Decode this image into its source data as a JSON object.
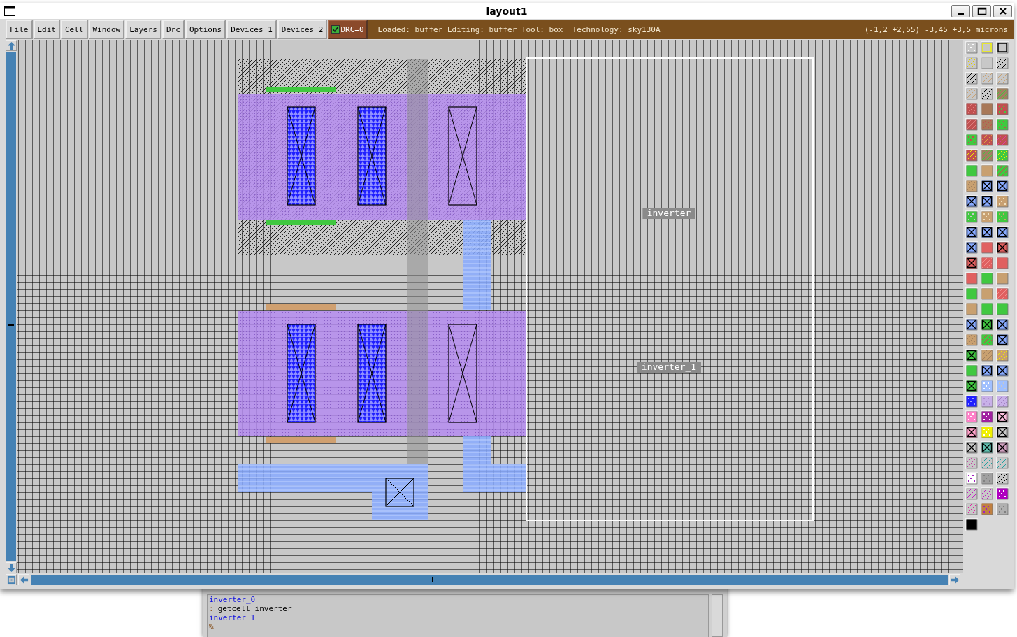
{
  "window": {
    "title": "layout1"
  },
  "menu": [
    "File",
    "Edit",
    "Cell",
    "Window",
    "Layers",
    "Drc",
    "Options",
    "Devices 1",
    "Devices 2"
  ],
  "drc": {
    "label": "DRC=0",
    "checked": true
  },
  "status": {
    "text": "Loaded: buffer Editing: buffer Tool: box  Technology: sky130A",
    "coordinates": "(-1,2 +2,55) -3,45 +3,5 microns"
  },
  "canvas": {
    "cell_labels": [
      "inverter",
      "inverter_1"
    ]
  },
  "console": {
    "lines": [
      {
        "kind": "output",
        "text": "inverter_0"
      },
      {
        "kind": "command",
        "prompt": ":",
        "text": "getcell inverter"
      },
      {
        "kind": "output",
        "text": "inverter_1"
      },
      {
        "kind": "prompt",
        "prompt": "%"
      }
    ]
  }
}
